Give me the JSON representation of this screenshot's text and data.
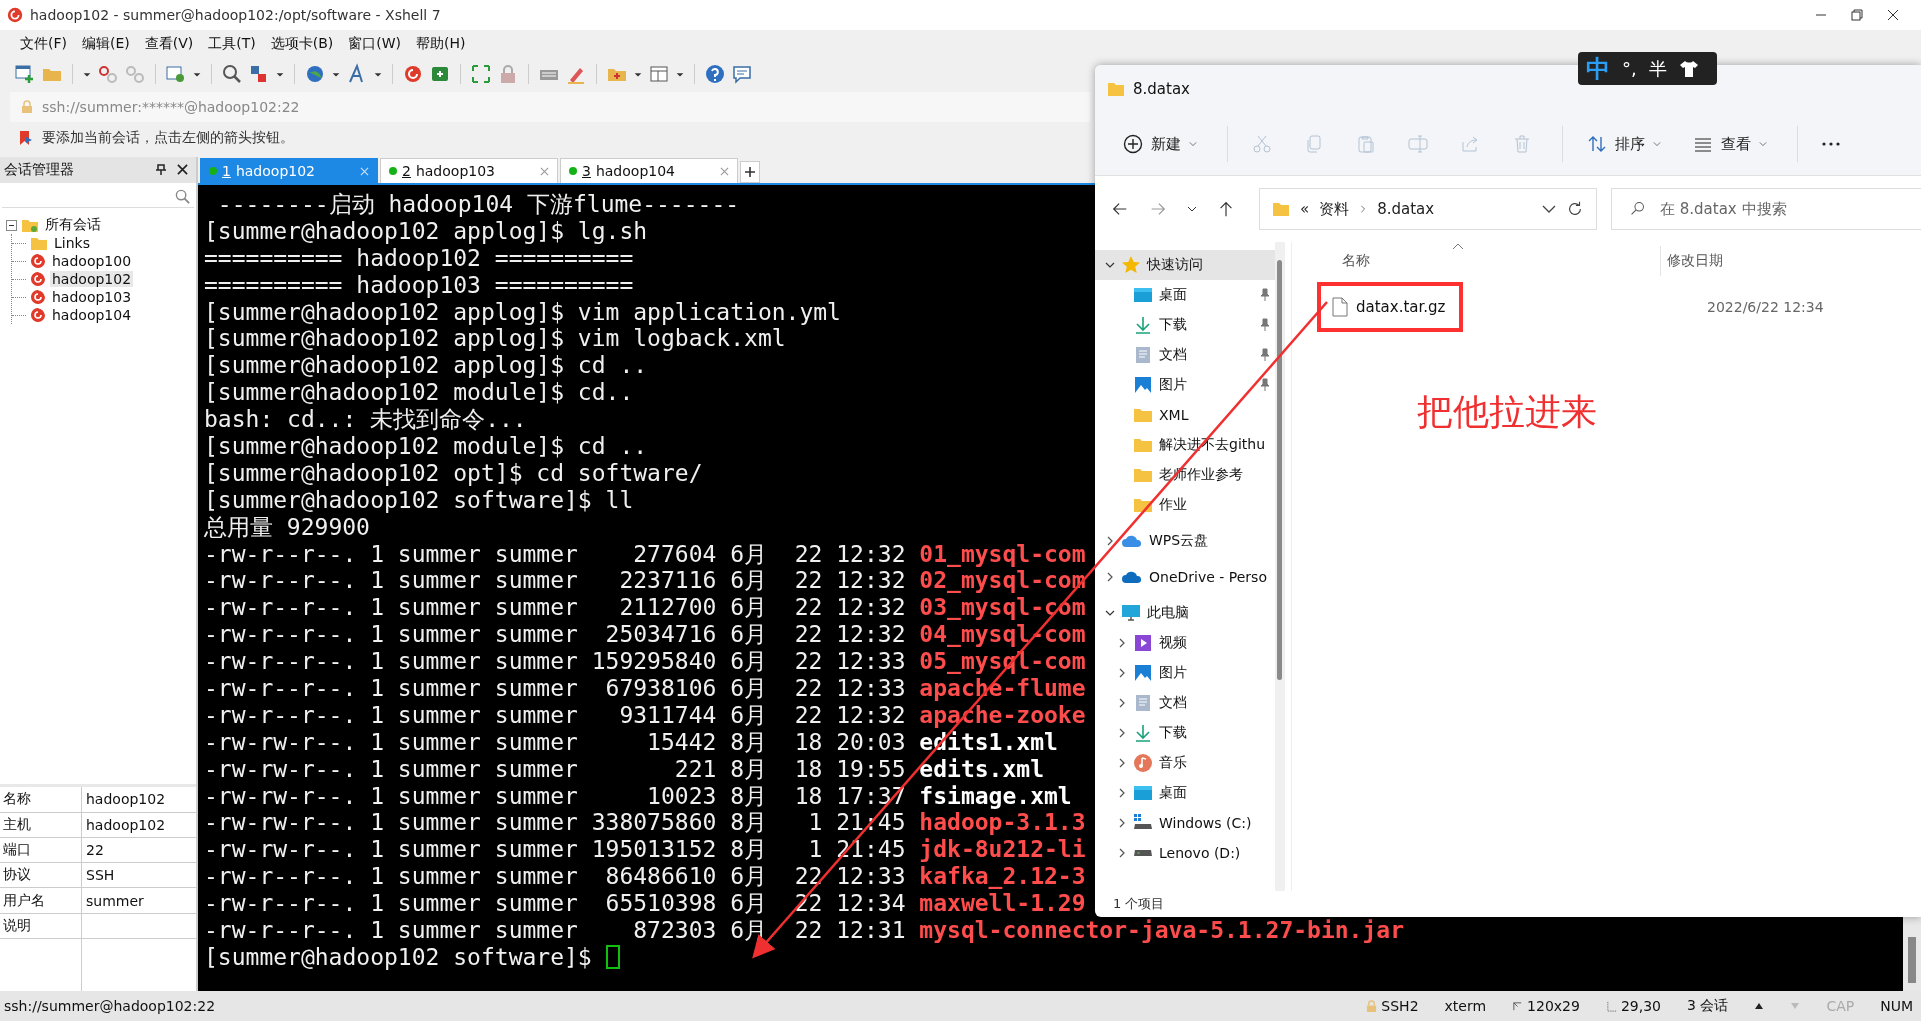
{
  "window": {
    "title": "hadoop102 - summer@hadoop102:/opt/software - Xshell 7"
  },
  "menu": [
    "文件(F)",
    "编辑(E)",
    "查看(V)",
    "工具(T)",
    "选项卡(B)",
    "窗口(W)",
    "帮助(H)"
  ],
  "address_bar": {
    "value": "ssh://summer:******@hadoop102:22"
  },
  "hint_bar": {
    "text": "要添加当前会话，点击左侧的箭头按钮。"
  },
  "session_manager": {
    "title": "会话管理器",
    "tree": [
      {
        "label": "所有会话",
        "kind": "group",
        "expanded": true,
        "selected": false,
        "children": [
          {
            "label": "Links",
            "kind": "folder",
            "selected": false
          },
          {
            "label": "hadoop100",
            "kind": "session",
            "selected": false
          },
          {
            "label": "hadoop102",
            "kind": "session",
            "selected": true
          },
          {
            "label": "hadoop103",
            "kind": "session",
            "selected": false
          },
          {
            "label": "hadoop104",
            "kind": "session",
            "selected": false
          }
        ]
      }
    ],
    "properties": [
      {
        "name": "名称",
        "value": "hadoop102"
      },
      {
        "name": "主机",
        "value": "hadoop102"
      },
      {
        "name": "端口",
        "value": "22"
      },
      {
        "name": "协议",
        "value": "SSH"
      },
      {
        "name": "用户名",
        "value": "summer"
      },
      {
        "name": "说明"
      }
    ]
  },
  "tabs": [
    {
      "number": "1",
      "label": "hadoop102",
      "selected": true
    },
    {
      "number": "2",
      "label": "hadoop103",
      "selected": false
    },
    {
      "number": "3",
      "label": "hadoop104",
      "selected": false
    }
  ],
  "terminal": {
    "lines": [
      {
        "kind": "text",
        "text": " --------启动 hadoop104 下游flume-------"
      },
      {
        "kind": "text",
        "text": "[summer@hadoop102 applog]$ lg.sh"
      },
      {
        "kind": "text",
        "text": "========== hadoop102 =========="
      },
      {
        "kind": "text",
        "text": "========== hadoop103 =========="
      },
      {
        "kind": "text",
        "text": "[summer@hadoop102 applog]$ vim application.yml"
      },
      {
        "kind": "text",
        "text": "[summer@hadoop102 applog]$ vim logback.xml"
      },
      {
        "kind": "text",
        "text": "[summer@hadoop102 applog]$ cd .."
      },
      {
        "kind": "text",
        "text": "[summer@hadoop102 module]$ cd.."
      },
      {
        "kind": "text",
        "text": "bash: cd..: 未找到命令..."
      },
      {
        "kind": "text",
        "text": "[summer@hadoop102 module]$ cd .."
      },
      {
        "kind": "text",
        "text": "[summer@hadoop102 opt]$ cd software/"
      },
      {
        "kind": "text",
        "text": "[summer@hadoop102 software]$ ll"
      },
      {
        "kind": "text",
        "text": "总用量 929900"
      },
      {
        "kind": "listing",
        "info": "-rw-r--r--. 1 summer summer    277604 6月  22 12:32",
        "name": "01_mysql-com",
        "color": "#ff4c4c"
      },
      {
        "kind": "listing",
        "info": "-rw-r--r--. 1 summer summer   2237116 6月  22 12:32",
        "name": "02_mysql-com",
        "color": "#ff4c4c"
      },
      {
        "kind": "listing",
        "info": "-rw-r--r--. 1 summer summer   2112700 6月  22 12:32",
        "name": "03_mysql-com",
        "color": "#ff4c4c"
      },
      {
        "kind": "listing",
        "info": "-rw-r--r--. 1 summer summer  25034716 6月  22 12:32",
        "name": "04_mysql-com",
        "color": "#ff4c4c"
      },
      {
        "kind": "listing",
        "info": "-rw-r--r--. 1 summer summer 159295840 6月  22 12:33",
        "name": "05_mysql-com",
        "color": "#ff4c4c"
      },
      {
        "kind": "listing",
        "info": "-rw-r--r--. 1 summer summer  67938106 6月  22 12:33",
        "name": "apache-flume",
        "color": "#ff4c4c"
      },
      {
        "kind": "listing",
        "info": "-rw-r--r--. 1 summer summer   9311744 6月  22 12:32",
        "name": "apache-zooke",
        "color": "#ff4c4c"
      },
      {
        "kind": "listing",
        "info": "-rw-rw-r--. 1 summer summer     15442 8月  18 20:03",
        "name": "edits1.xml",
        "color": "#ffffff"
      },
      {
        "kind": "listing",
        "info": "-rw-rw-r--. 1 summer summer       221 8月  18 19:55",
        "name": "edits.xml",
        "color": "#ffffff"
      },
      {
        "kind": "listing",
        "info": "-rw-rw-r--. 1 summer summer     10023 8月  18 17:37",
        "name": "fsimage.xml",
        "color": "#ffffff"
      },
      {
        "kind": "listing",
        "info": "-rw-rw-r--. 1 summer summer 338075860 8月   1 21:45",
        "name": "hadoop-3.1.3",
        "color": "#ff4c4c"
      },
      {
        "kind": "listing",
        "info": "-rw-rw-r--. 1 summer summer 195013152 8月   1 21:45",
        "name": "jdk-8u212-li",
        "color": "#ff4c4c"
      },
      {
        "kind": "listing",
        "info": "-rw-r--r--. 1 summer summer  86486610 6月  22 12:33",
        "name": "kafka_2.12-3",
        "color": "#ff4c4c"
      },
      {
        "kind": "listing",
        "info": "-rw-r--r--. 1 summer summer  65510398 6月  22 12:34",
        "name": "maxwell-1.29",
        "color": "#ff4c4c"
      },
      {
        "kind": "listing",
        "info": "-rw-r--r--. 1 summer summer    872303 6月  22 12:31",
        "name": "mysql-connector-java-5.1.27-bin.jar",
        "color": "#ff4c4c"
      }
    ],
    "prompt": "[summer@hadoop102 software]$"
  },
  "status_bar": {
    "left": "ssh://summer@hadoop102:22",
    "items": [
      {
        "kind": "lock",
        "text": "SSH2"
      },
      {
        "kind": "plain",
        "text": "xterm"
      },
      {
        "kind": "size",
        "text": "120x29"
      },
      {
        "kind": "cursor",
        "text": "29,30"
      },
      {
        "kind": "plain",
        "text": "3 会话"
      }
    ],
    "keys": [
      {
        "text": "CAP",
        "on": false
      },
      {
        "text": "NUM",
        "on": true
      }
    ]
  },
  "ime": {
    "mode": "中",
    "punct": "°,",
    "width": "半"
  },
  "explorer": {
    "title": "8.datax",
    "toolbar": [
      {
        "kind": "new",
        "label": "新建",
        "disabled": false
      },
      {
        "kind": "cut",
        "disabled": true
      },
      {
        "kind": "copy",
        "disabled": true
      },
      {
        "kind": "paste",
        "disabled": true
      },
      {
        "kind": "rename",
        "disabled": true
      },
      {
        "kind": "share",
        "disabled": true
      },
      {
        "kind": "delete",
        "disabled": true
      },
      {
        "kind": "sort",
        "label": "排序",
        "disabled": false
      },
      {
        "kind": "view",
        "label": "查看",
        "disabled": false
      },
      {
        "kind": "more",
        "disabled": false
      }
    ],
    "breadcrumb": {
      "overflow": "«",
      "parts": [
        "资料",
        "8.datax"
      ]
    },
    "search": {
      "placeholder": "在 8.datax 中搜索"
    },
    "nav": [
      {
        "label": "快速访问",
        "kind": "star",
        "expanded": true,
        "selected": true,
        "children": [
          {
            "label": "桌面",
            "kind": "desktop",
            "pinned": true
          },
          {
            "label": "下载",
            "kind": "download",
            "pinned": true
          },
          {
            "label": "文档",
            "kind": "document",
            "pinned": true
          },
          {
            "label": "图片",
            "kind": "picture",
            "pinned": true
          },
          {
            "label": "XML",
            "kind": "folder",
            "pinned": false
          },
          {
            "label": "解决进不去githu",
            "kind": "folder",
            "pinned": false
          },
          {
            "label": "老师作业参考",
            "kind": "folder",
            "pinned": false
          },
          {
            "label": "作业",
            "kind": "folder",
            "pinned": false
          }
        ]
      },
      {
        "label": "WPS云盘",
        "kind": "cloud",
        "expanded": false,
        "selected": false
      },
      {
        "label": "OneDrive - Perso",
        "kind": "onedrive",
        "expanded": false,
        "selected": false
      },
      {
        "label": "此电脑",
        "kind": "computer",
        "expanded": true,
        "selected": false,
        "children": [
          {
            "label": "视频",
            "kind": "video",
            "expanded": false
          },
          {
            "label": "图片",
            "kind": "picture",
            "expanded": false
          },
          {
            "label": "文档",
            "kind": "document",
            "expanded": false
          },
          {
            "label": "下载",
            "kind": "download",
            "expanded": false
          },
          {
            "label": "音乐",
            "kind": "music",
            "expanded": false
          },
          {
            "label": "桌面",
            "kind": "desktop",
            "expanded": false
          },
          {
            "label": "Windows (C:)",
            "kind": "windrive",
            "expanded": false
          },
          {
            "label": "Lenovo (D:)",
            "kind": "drive",
            "expanded": false
          }
        ]
      }
    ],
    "columns": [
      "名称",
      "修改日期"
    ],
    "files": [
      {
        "name": "datax.tar.gz",
        "modified": "2022/6/22 12:34",
        "highlighted": true
      }
    ],
    "status": "1 个项目"
  },
  "annotation": {
    "text": "把他拉进来"
  }
}
